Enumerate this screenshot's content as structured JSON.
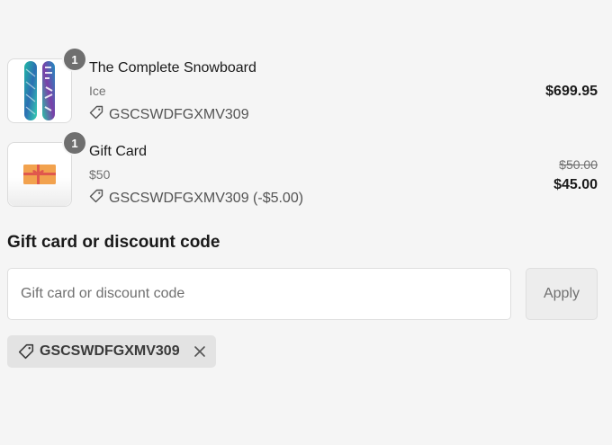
{
  "line_items": [
    {
      "title": "The Complete Snowboard",
      "variant": "Ice",
      "quantity": "1",
      "discount_code": "GSCSWDFGXMV309",
      "price": "$699.95",
      "image_icon": "snowboard-image"
    },
    {
      "title": "Gift Card",
      "variant": "$50",
      "quantity": "1",
      "discount_code": "GSCSWDFGXMV309 (-$5.00)",
      "original_price": "$50.00",
      "price": "$45.00",
      "image_icon": "gift-card-image"
    }
  ],
  "discount_section": {
    "heading": "Gift card or discount code",
    "input_placeholder": "Gift card or discount code",
    "input_value": "",
    "apply_label": "Apply",
    "applied_code": "GSCSWDFGXMV309",
    "tag_icon": "tag-icon",
    "remove_icon": "close-icon"
  },
  "colors": {
    "background": "#f5f5f5",
    "text": "#1a1a1a",
    "muted_text": "#707070",
    "quantity_badge": "#6f6f6f",
    "tag_background": "#e3e3e3"
  }
}
